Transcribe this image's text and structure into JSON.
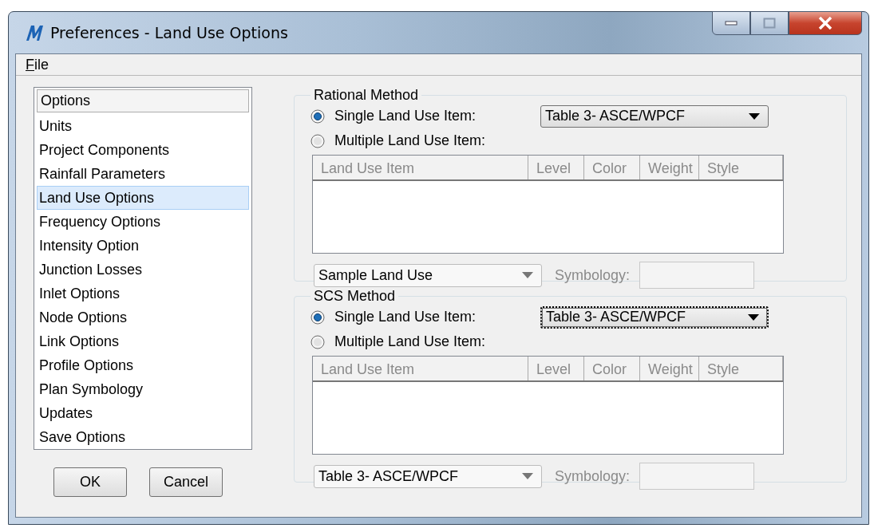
{
  "window": {
    "title": "Preferences - Land Use Options"
  },
  "menu": [
    {
      "label": "File"
    }
  ],
  "options_list": {
    "header": "Options",
    "items": [
      {
        "label": "Units",
        "selected": false
      },
      {
        "label": "Project Components",
        "selected": false
      },
      {
        "label": "Rainfall Parameters",
        "selected": false
      },
      {
        "label": "Land Use Options",
        "selected": true
      },
      {
        "label": "Frequency Options",
        "selected": false
      },
      {
        "label": "Intensity Option",
        "selected": false
      },
      {
        "label": "Junction Losses",
        "selected": false
      },
      {
        "label": "Inlet Options",
        "selected": false
      },
      {
        "label": "Node Options",
        "selected": false
      },
      {
        "label": "Link Options",
        "selected": false
      },
      {
        "label": "Profile Options",
        "selected": false
      },
      {
        "label": "Plan Symbology",
        "selected": false
      },
      {
        "label": "Updates",
        "selected": false
      },
      {
        "label": "Save Options",
        "selected": false
      }
    ]
  },
  "buttons": [
    {
      "label": "OK"
    },
    {
      "label": "Cancel"
    }
  ],
  "groups": [
    {
      "title": "Rational Method",
      "radios": [
        {
          "label": "Single Land Use Item:",
          "selected": true
        },
        {
          "label": "Multiple Land Use Item:",
          "selected": false
        }
      ],
      "table_dropdown": {
        "value": "Table 3- ASCE/WPCF",
        "focused": false
      },
      "columns": [
        "Land Use Item",
        "Level",
        "Color",
        "Weight",
        "Style"
      ],
      "item_dropdown": {
        "value": "Sample Land Use",
        "disabled": true
      },
      "symbology_label": "Symbology:"
    },
    {
      "title": "SCS Method",
      "radios": [
        {
          "label": "Single Land Use Item:",
          "selected": true
        },
        {
          "label": "Multiple Land Use Item:",
          "selected": false
        }
      ],
      "table_dropdown": {
        "value": "Table 3- ASCE/WPCF",
        "focused": true
      },
      "columns": [
        "Land Use Item",
        "Level",
        "Color",
        "Weight",
        "Style"
      ],
      "item_dropdown": {
        "value": "Table 3- ASCE/WPCF",
        "disabled": true
      },
      "symbology_label": "Symbology:"
    }
  ]
}
